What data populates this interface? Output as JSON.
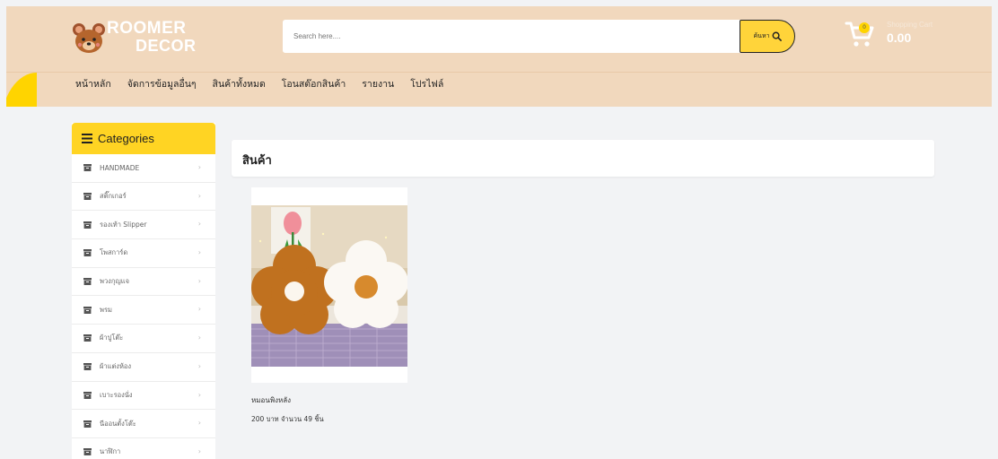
{
  "brand": {
    "line1": "ROOMER",
    "line2": "DECOR"
  },
  "search": {
    "placeholder": "Search here....",
    "button_label": "ค้นหา"
  },
  "cart": {
    "badge": "0",
    "label": "Shopping Cart",
    "total": "0.00"
  },
  "nav": {
    "items": [
      "หน้าหลัก",
      "จัดการข้อมูลอื่นๆ",
      "สินค้าทั้งหมด",
      "โอนสต๊อกสินค้า",
      "รายงาน",
      "โปรไฟล์"
    ]
  },
  "sidebar": {
    "title": "Categories",
    "items": [
      "HANDMADE",
      "สติ๊กเกอร์",
      "รองเท้า Slipper",
      "โพสการ์ด",
      "พวงกุญแจ",
      "พรม",
      "ผ้าปูโต๊ะ",
      "ผ้าแต่งห้อง",
      "เบาะรองนั่ง",
      "นีออนตั้งโต๊ะ",
      "นาฬิกา"
    ]
  },
  "main": {
    "title": "สินค้า"
  },
  "product": {
    "name": "หมอนพิงหลัง",
    "price_text": "200 บาท จำนวน 49  ชิ้น"
  },
  "colors": {
    "header_bg": "#f1d8bd",
    "accent": "#ffd423",
    "page_bg": "#f2f3f5"
  }
}
